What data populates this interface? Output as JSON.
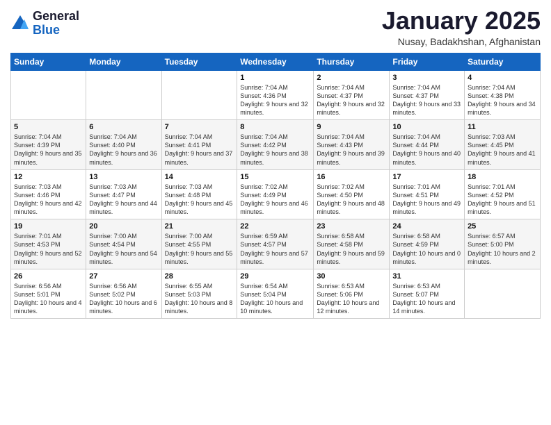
{
  "logo": {
    "general": "General",
    "blue": "Blue"
  },
  "header": {
    "month": "January 2025",
    "location": "Nusay, Badakhshan, Afghanistan"
  },
  "weekdays": [
    "Sunday",
    "Monday",
    "Tuesday",
    "Wednesday",
    "Thursday",
    "Friday",
    "Saturday"
  ],
  "weeks": [
    [
      {
        "day": "",
        "info": ""
      },
      {
        "day": "",
        "info": ""
      },
      {
        "day": "",
        "info": ""
      },
      {
        "day": "1",
        "info": "Sunrise: 7:04 AM\nSunset: 4:36 PM\nDaylight: 9 hours\nand 32 minutes."
      },
      {
        "day": "2",
        "info": "Sunrise: 7:04 AM\nSunset: 4:37 PM\nDaylight: 9 hours\nand 32 minutes."
      },
      {
        "day": "3",
        "info": "Sunrise: 7:04 AM\nSunset: 4:37 PM\nDaylight: 9 hours\nand 33 minutes."
      },
      {
        "day": "4",
        "info": "Sunrise: 7:04 AM\nSunset: 4:38 PM\nDaylight: 9 hours\nand 34 minutes."
      }
    ],
    [
      {
        "day": "5",
        "info": "Sunrise: 7:04 AM\nSunset: 4:39 PM\nDaylight: 9 hours\nand 35 minutes."
      },
      {
        "day": "6",
        "info": "Sunrise: 7:04 AM\nSunset: 4:40 PM\nDaylight: 9 hours\nand 36 minutes."
      },
      {
        "day": "7",
        "info": "Sunrise: 7:04 AM\nSunset: 4:41 PM\nDaylight: 9 hours\nand 37 minutes."
      },
      {
        "day": "8",
        "info": "Sunrise: 7:04 AM\nSunset: 4:42 PM\nDaylight: 9 hours\nand 38 minutes."
      },
      {
        "day": "9",
        "info": "Sunrise: 7:04 AM\nSunset: 4:43 PM\nDaylight: 9 hours\nand 39 minutes."
      },
      {
        "day": "10",
        "info": "Sunrise: 7:04 AM\nSunset: 4:44 PM\nDaylight: 9 hours\nand 40 minutes."
      },
      {
        "day": "11",
        "info": "Sunrise: 7:03 AM\nSunset: 4:45 PM\nDaylight: 9 hours\nand 41 minutes."
      }
    ],
    [
      {
        "day": "12",
        "info": "Sunrise: 7:03 AM\nSunset: 4:46 PM\nDaylight: 9 hours\nand 42 minutes."
      },
      {
        "day": "13",
        "info": "Sunrise: 7:03 AM\nSunset: 4:47 PM\nDaylight: 9 hours\nand 44 minutes."
      },
      {
        "day": "14",
        "info": "Sunrise: 7:03 AM\nSunset: 4:48 PM\nDaylight: 9 hours\nand 45 minutes."
      },
      {
        "day": "15",
        "info": "Sunrise: 7:02 AM\nSunset: 4:49 PM\nDaylight: 9 hours\nand 46 minutes."
      },
      {
        "day": "16",
        "info": "Sunrise: 7:02 AM\nSunset: 4:50 PM\nDaylight: 9 hours\nand 48 minutes."
      },
      {
        "day": "17",
        "info": "Sunrise: 7:01 AM\nSunset: 4:51 PM\nDaylight: 9 hours\nand 49 minutes."
      },
      {
        "day": "18",
        "info": "Sunrise: 7:01 AM\nSunset: 4:52 PM\nDaylight: 9 hours\nand 51 minutes."
      }
    ],
    [
      {
        "day": "19",
        "info": "Sunrise: 7:01 AM\nSunset: 4:53 PM\nDaylight: 9 hours\nand 52 minutes."
      },
      {
        "day": "20",
        "info": "Sunrise: 7:00 AM\nSunset: 4:54 PM\nDaylight: 9 hours\nand 54 minutes."
      },
      {
        "day": "21",
        "info": "Sunrise: 7:00 AM\nSunset: 4:55 PM\nDaylight: 9 hours\nand 55 minutes."
      },
      {
        "day": "22",
        "info": "Sunrise: 6:59 AM\nSunset: 4:57 PM\nDaylight: 9 hours\nand 57 minutes."
      },
      {
        "day": "23",
        "info": "Sunrise: 6:58 AM\nSunset: 4:58 PM\nDaylight: 9 hours\nand 59 minutes."
      },
      {
        "day": "24",
        "info": "Sunrise: 6:58 AM\nSunset: 4:59 PM\nDaylight: 10 hours\nand 0 minutes."
      },
      {
        "day": "25",
        "info": "Sunrise: 6:57 AM\nSunset: 5:00 PM\nDaylight: 10 hours\nand 2 minutes."
      }
    ],
    [
      {
        "day": "26",
        "info": "Sunrise: 6:56 AM\nSunset: 5:01 PM\nDaylight: 10 hours\nand 4 minutes."
      },
      {
        "day": "27",
        "info": "Sunrise: 6:56 AM\nSunset: 5:02 PM\nDaylight: 10 hours\nand 6 minutes."
      },
      {
        "day": "28",
        "info": "Sunrise: 6:55 AM\nSunset: 5:03 PM\nDaylight: 10 hours\nand 8 minutes."
      },
      {
        "day": "29",
        "info": "Sunrise: 6:54 AM\nSunset: 5:04 PM\nDaylight: 10 hours\nand 10 minutes."
      },
      {
        "day": "30",
        "info": "Sunrise: 6:53 AM\nSunset: 5:06 PM\nDaylight: 10 hours\nand 12 minutes."
      },
      {
        "day": "31",
        "info": "Sunrise: 6:53 AM\nSunset: 5:07 PM\nDaylight: 10 hours\nand 14 minutes."
      },
      {
        "day": "",
        "info": ""
      }
    ]
  ]
}
